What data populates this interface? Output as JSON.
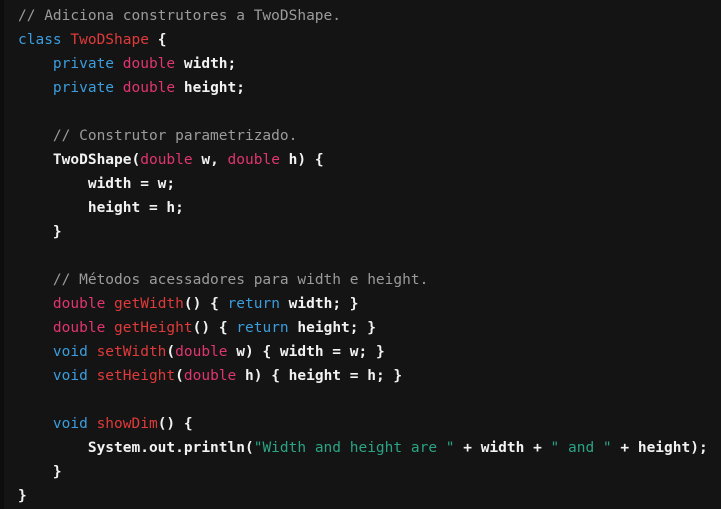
{
  "editor": {
    "language": "java",
    "theme_name": "dark",
    "background_color": "#141414",
    "gutter_color": "#0d0d0d",
    "colors": {
      "comment": "#9b9b9b",
      "keyword": "#3b9ddd",
      "type": "#e0356f",
      "class_name": "#e03a3a",
      "method_name": "#e03a3a",
      "string": "#2aa484",
      "plain": "#f2f2f2"
    }
  },
  "code": {
    "lines": [
      {
        "indent": 0,
        "tokens": [
          {
            "kind": "comment",
            "text": "// Adiciona construtores a TwoDShape."
          }
        ]
      },
      {
        "indent": 0,
        "tokens": [
          {
            "kind": "keyword",
            "text": "class"
          },
          {
            "kind": "plain",
            "text": " "
          },
          {
            "kind": "class_name",
            "text": "TwoDShape"
          },
          {
            "kind": "plain",
            "text": " "
          },
          {
            "kind": "punct",
            "text": "{"
          }
        ]
      },
      {
        "indent": 4,
        "tokens": [
          {
            "kind": "keyword",
            "text": "private"
          },
          {
            "kind": "plain",
            "text": " "
          },
          {
            "kind": "type",
            "text": "double"
          },
          {
            "kind": "plain",
            "text": " "
          },
          {
            "kind": "plain",
            "text": "width;"
          }
        ]
      },
      {
        "indent": 4,
        "tokens": [
          {
            "kind": "keyword",
            "text": "private"
          },
          {
            "kind": "plain",
            "text": " "
          },
          {
            "kind": "type",
            "text": "double"
          },
          {
            "kind": "plain",
            "text": " "
          },
          {
            "kind": "plain",
            "text": "height;"
          }
        ]
      },
      {
        "indent": 0,
        "tokens": []
      },
      {
        "indent": 4,
        "tokens": [
          {
            "kind": "comment",
            "text": "// Construtor parametrizado."
          }
        ]
      },
      {
        "indent": 4,
        "tokens": [
          {
            "kind": "plain",
            "text": "TwoDShape("
          },
          {
            "kind": "type",
            "text": "double"
          },
          {
            "kind": "plain",
            "text": " w, "
          },
          {
            "kind": "type",
            "text": "double"
          },
          {
            "kind": "plain",
            "text": " h) {"
          }
        ]
      },
      {
        "indent": 8,
        "tokens": [
          {
            "kind": "plain",
            "text": "width = w;"
          }
        ]
      },
      {
        "indent": 8,
        "tokens": [
          {
            "kind": "plain",
            "text": "height = h;"
          }
        ]
      },
      {
        "indent": 4,
        "tokens": [
          {
            "kind": "punct",
            "text": "}"
          }
        ]
      },
      {
        "indent": 0,
        "tokens": []
      },
      {
        "indent": 4,
        "tokens": [
          {
            "kind": "comment",
            "text": "// Métodos acessadores para width e height."
          }
        ]
      },
      {
        "indent": 4,
        "tokens": [
          {
            "kind": "type",
            "text": "double"
          },
          {
            "kind": "plain",
            "text": " "
          },
          {
            "kind": "method_name",
            "text": "getWidth"
          },
          {
            "kind": "plain",
            "text": "() { "
          },
          {
            "kind": "keyword",
            "text": "return"
          },
          {
            "kind": "plain",
            "text": " width; }"
          }
        ]
      },
      {
        "indent": 4,
        "tokens": [
          {
            "kind": "type",
            "text": "double"
          },
          {
            "kind": "plain",
            "text": " "
          },
          {
            "kind": "method_name",
            "text": "getHeight"
          },
          {
            "kind": "plain",
            "text": "() { "
          },
          {
            "kind": "keyword",
            "text": "return"
          },
          {
            "kind": "plain",
            "text": " height; }"
          }
        ]
      },
      {
        "indent": 4,
        "tokens": [
          {
            "kind": "keyword",
            "text": "void"
          },
          {
            "kind": "plain",
            "text": " "
          },
          {
            "kind": "method_name",
            "text": "setWidth"
          },
          {
            "kind": "plain",
            "text": "("
          },
          {
            "kind": "type",
            "text": "double"
          },
          {
            "kind": "plain",
            "text": " w) { width = w; }"
          }
        ]
      },
      {
        "indent": 4,
        "tokens": [
          {
            "kind": "keyword",
            "text": "void"
          },
          {
            "kind": "plain",
            "text": " "
          },
          {
            "kind": "method_name",
            "text": "setHeight"
          },
          {
            "kind": "plain",
            "text": "("
          },
          {
            "kind": "type",
            "text": "double"
          },
          {
            "kind": "plain",
            "text": " h) { height = h; }"
          }
        ]
      },
      {
        "indent": 0,
        "tokens": []
      },
      {
        "indent": 4,
        "tokens": [
          {
            "kind": "keyword",
            "text": "void"
          },
          {
            "kind": "plain",
            "text": " "
          },
          {
            "kind": "method_name",
            "text": "showDim"
          },
          {
            "kind": "plain",
            "text": "() {"
          }
        ]
      },
      {
        "indent": 8,
        "tokens": [
          {
            "kind": "plain",
            "text": "System.out.println("
          },
          {
            "kind": "string",
            "text": "\"Width and height are \""
          },
          {
            "kind": "plain",
            "text": " + width + "
          },
          {
            "kind": "string",
            "text": "\" and \""
          },
          {
            "kind": "plain",
            "text": " + height);"
          }
        ]
      },
      {
        "indent": 4,
        "tokens": [
          {
            "kind": "punct",
            "text": "}"
          }
        ]
      },
      {
        "indent": 0,
        "tokens": [
          {
            "kind": "punct",
            "text": "}"
          }
        ]
      }
    ]
  }
}
